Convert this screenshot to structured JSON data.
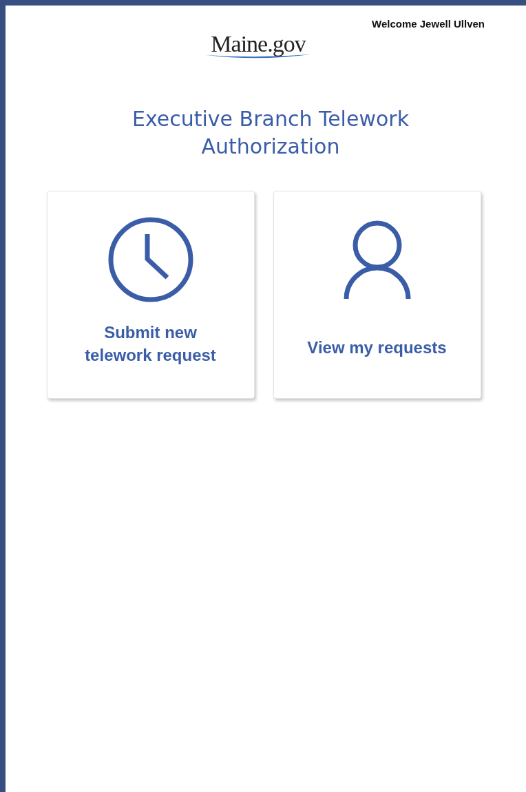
{
  "header": {
    "welcome": "Welcome Jewell Ullven",
    "logo": "Maine.gov"
  },
  "title": "Executive Branch Telework Authorization",
  "cards": [
    {
      "kind": "clock",
      "label": "Submit new telework request"
    },
    {
      "kind": "person",
      "label": "View my requests"
    }
  ]
}
